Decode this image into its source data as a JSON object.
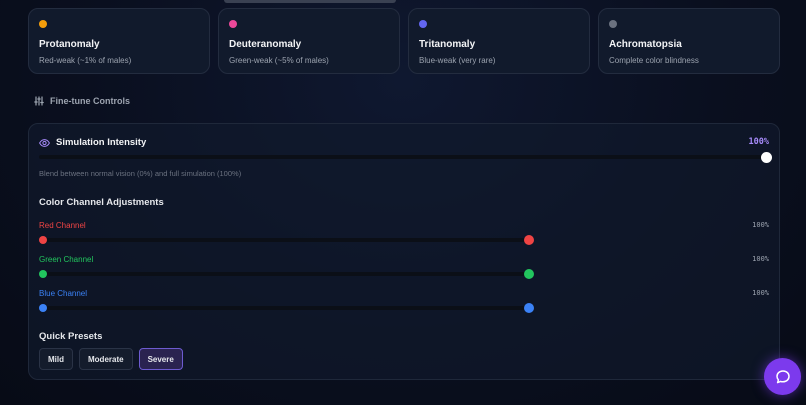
{
  "cards": [
    {
      "name": "Protanomaly",
      "desc": "Red-weak (~1% of males)",
      "color": "#f59e0b"
    },
    {
      "name": "Deuteranomaly",
      "desc": "Green-weak (~5% of males)",
      "color": "#ec4899"
    },
    {
      "name": "Tritanomaly",
      "desc": "Blue-weak (very rare)",
      "color": "#6366f1"
    },
    {
      "name": "Achromatopsia",
      "desc": "Complete color blindness",
      "color": "#6b7280"
    }
  ],
  "controls": {
    "title": "Fine-tune Controls",
    "intensity": {
      "label": "Simulation Intensity",
      "value_text": "100%",
      "value": 1.0,
      "helper": "Blend between normal vision (0%) and full simulation (100%)"
    },
    "channels_title": "Color Channel Adjustments",
    "channels": [
      {
        "label": "Red Channel",
        "value_text": "100%",
        "value": 1.0,
        "color": "#ef4444"
      },
      {
        "label": "Green Channel",
        "value_text": "100%",
        "value": 1.0,
        "color": "#22c55e"
      },
      {
        "label": "Blue Channel",
        "value_text": "100%",
        "value": 1.0,
        "color": "#3b82f6"
      }
    ],
    "presets_title": "Quick Presets",
    "presets": [
      {
        "label": "Mild",
        "active": false
      },
      {
        "label": "Moderate",
        "active": false
      },
      {
        "label": "Severe",
        "active": true
      }
    ]
  }
}
